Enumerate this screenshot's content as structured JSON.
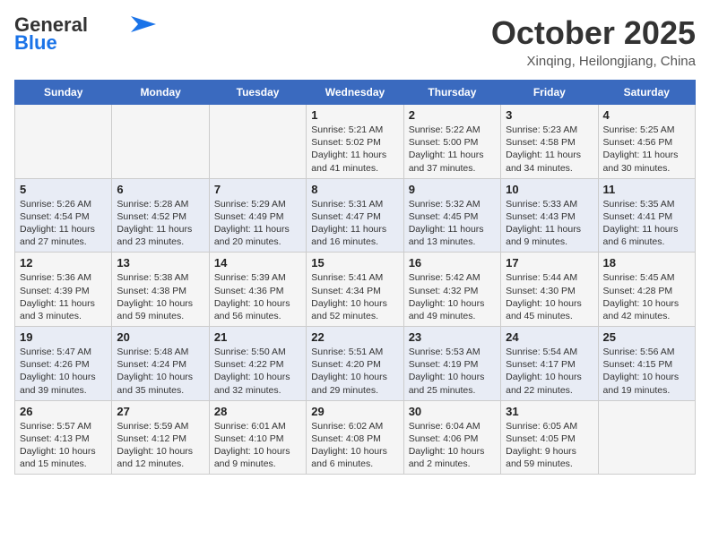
{
  "header": {
    "logo_general": "General",
    "logo_blue": "Blue",
    "month_year": "October 2025",
    "location": "Xinqing, Heilongjiang, China"
  },
  "days_of_week": [
    "Sunday",
    "Monday",
    "Tuesday",
    "Wednesday",
    "Thursday",
    "Friday",
    "Saturday"
  ],
  "weeks": [
    [
      {
        "day": "",
        "info": ""
      },
      {
        "day": "",
        "info": ""
      },
      {
        "day": "",
        "info": ""
      },
      {
        "day": "1",
        "info": "Sunrise: 5:21 AM\nSunset: 5:02 PM\nDaylight: 11 hours\nand 41 minutes."
      },
      {
        "day": "2",
        "info": "Sunrise: 5:22 AM\nSunset: 5:00 PM\nDaylight: 11 hours\nand 37 minutes."
      },
      {
        "day": "3",
        "info": "Sunrise: 5:23 AM\nSunset: 4:58 PM\nDaylight: 11 hours\nand 34 minutes."
      },
      {
        "day": "4",
        "info": "Sunrise: 5:25 AM\nSunset: 4:56 PM\nDaylight: 11 hours\nand 30 minutes."
      }
    ],
    [
      {
        "day": "5",
        "info": "Sunrise: 5:26 AM\nSunset: 4:54 PM\nDaylight: 11 hours\nand 27 minutes."
      },
      {
        "day": "6",
        "info": "Sunrise: 5:28 AM\nSunset: 4:52 PM\nDaylight: 11 hours\nand 23 minutes."
      },
      {
        "day": "7",
        "info": "Sunrise: 5:29 AM\nSunset: 4:49 PM\nDaylight: 11 hours\nand 20 minutes."
      },
      {
        "day": "8",
        "info": "Sunrise: 5:31 AM\nSunset: 4:47 PM\nDaylight: 11 hours\nand 16 minutes."
      },
      {
        "day": "9",
        "info": "Sunrise: 5:32 AM\nSunset: 4:45 PM\nDaylight: 11 hours\nand 13 minutes."
      },
      {
        "day": "10",
        "info": "Sunrise: 5:33 AM\nSunset: 4:43 PM\nDaylight: 11 hours\nand 9 minutes."
      },
      {
        "day": "11",
        "info": "Sunrise: 5:35 AM\nSunset: 4:41 PM\nDaylight: 11 hours\nand 6 minutes."
      }
    ],
    [
      {
        "day": "12",
        "info": "Sunrise: 5:36 AM\nSunset: 4:39 PM\nDaylight: 11 hours\nand 3 minutes."
      },
      {
        "day": "13",
        "info": "Sunrise: 5:38 AM\nSunset: 4:38 PM\nDaylight: 10 hours\nand 59 minutes."
      },
      {
        "day": "14",
        "info": "Sunrise: 5:39 AM\nSunset: 4:36 PM\nDaylight: 10 hours\nand 56 minutes."
      },
      {
        "day": "15",
        "info": "Sunrise: 5:41 AM\nSunset: 4:34 PM\nDaylight: 10 hours\nand 52 minutes."
      },
      {
        "day": "16",
        "info": "Sunrise: 5:42 AM\nSunset: 4:32 PM\nDaylight: 10 hours\nand 49 minutes."
      },
      {
        "day": "17",
        "info": "Sunrise: 5:44 AM\nSunset: 4:30 PM\nDaylight: 10 hours\nand 45 minutes."
      },
      {
        "day": "18",
        "info": "Sunrise: 5:45 AM\nSunset: 4:28 PM\nDaylight: 10 hours\nand 42 minutes."
      }
    ],
    [
      {
        "day": "19",
        "info": "Sunrise: 5:47 AM\nSunset: 4:26 PM\nDaylight: 10 hours\nand 39 minutes."
      },
      {
        "day": "20",
        "info": "Sunrise: 5:48 AM\nSunset: 4:24 PM\nDaylight: 10 hours\nand 35 minutes."
      },
      {
        "day": "21",
        "info": "Sunrise: 5:50 AM\nSunset: 4:22 PM\nDaylight: 10 hours\nand 32 minutes."
      },
      {
        "day": "22",
        "info": "Sunrise: 5:51 AM\nSunset: 4:20 PM\nDaylight: 10 hours\nand 29 minutes."
      },
      {
        "day": "23",
        "info": "Sunrise: 5:53 AM\nSunset: 4:19 PM\nDaylight: 10 hours\nand 25 minutes."
      },
      {
        "day": "24",
        "info": "Sunrise: 5:54 AM\nSunset: 4:17 PM\nDaylight: 10 hours\nand 22 minutes."
      },
      {
        "day": "25",
        "info": "Sunrise: 5:56 AM\nSunset: 4:15 PM\nDaylight: 10 hours\nand 19 minutes."
      }
    ],
    [
      {
        "day": "26",
        "info": "Sunrise: 5:57 AM\nSunset: 4:13 PM\nDaylight: 10 hours\nand 15 minutes."
      },
      {
        "day": "27",
        "info": "Sunrise: 5:59 AM\nSunset: 4:12 PM\nDaylight: 10 hours\nand 12 minutes."
      },
      {
        "day": "28",
        "info": "Sunrise: 6:01 AM\nSunset: 4:10 PM\nDaylight: 10 hours\nand 9 minutes."
      },
      {
        "day": "29",
        "info": "Sunrise: 6:02 AM\nSunset: 4:08 PM\nDaylight: 10 hours\nand 6 minutes."
      },
      {
        "day": "30",
        "info": "Sunrise: 6:04 AM\nSunset: 4:06 PM\nDaylight: 10 hours\nand 2 minutes."
      },
      {
        "day": "31",
        "info": "Sunrise: 6:05 AM\nSunset: 4:05 PM\nDaylight: 9 hours\nand 59 minutes."
      },
      {
        "day": "",
        "info": ""
      }
    ]
  ]
}
